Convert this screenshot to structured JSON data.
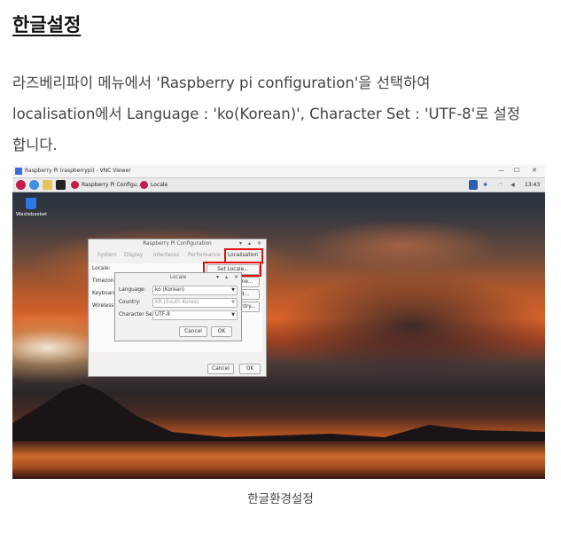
{
  "heading": "한글설정",
  "para_lines": [
    "라즈베리파이 메뉴에서  'Raspberry pi configuration'을 선택하여",
    "localisation에서 Language : 'ko(Korean)', Character Set : 'UTF-8'로 설정",
    "합니다."
  ],
  "vnc": {
    "title": "Raspberry Pi (raspberrypi) - VNC Viewer",
    "win_min": "—",
    "win_max": "☐",
    "win_close": "✕"
  },
  "taskbar": {
    "app1": "Raspberry Pi Configu...",
    "app2": "Locale",
    "clock": "13:43",
    "icon_names": [
      "raspberry-icon",
      "globe-icon",
      "folder-icon",
      "terminal-icon"
    ]
  },
  "desktop": {
    "trash_label": "Wastebasket"
  },
  "config": {
    "title": "Raspberry Pi Configuration",
    "tabs": [
      "System",
      "Display",
      "Interfaces",
      "Performance",
      "Localisation"
    ],
    "rows": [
      "Locale:",
      "Timezone:",
      "Keyboard:",
      "Wireless L"
    ],
    "btn_locale": "Set Locale...",
    "btn_timezone": "Set Timezone...",
    "btn_keyboard": "d...",
    "btn_wifi": "ountry...",
    "cancel": "Cancel",
    "ok": "OK",
    "ctrl_down": "▾",
    "ctrl_up": "▴",
    "ctrl_close": "✕"
  },
  "locale": {
    "title": "Locale",
    "language_label": "Language:",
    "language_value": "ko (Korean)",
    "country_label": "Country:",
    "country_value": "KR (South Korea)",
    "charset_label": "Character Set:",
    "charset_value": "UTF-8",
    "cancel": "Cancel",
    "ok": "OK"
  },
  "caption": "한글환경설정",
  "colors": {
    "highlight": "#e01010",
    "accent": "#2d78e6"
  }
}
